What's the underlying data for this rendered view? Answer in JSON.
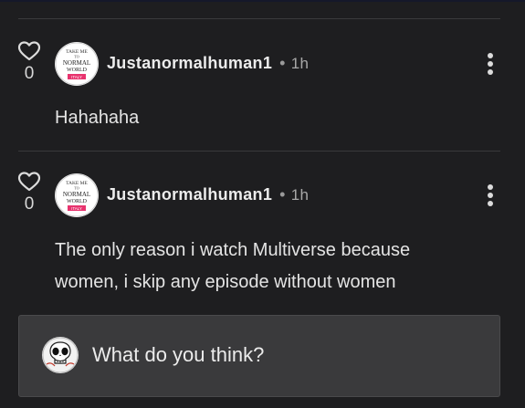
{
  "comments": [
    {
      "likes": "0",
      "username": "Justanormalhuman1",
      "separator": "•",
      "time": "1h",
      "text": "Hahahaha",
      "avatar_text": [
        "TAKE ME",
        "TO",
        "NORMAL",
        "WORLD",
        "ITALY"
      ]
    },
    {
      "likes": "0",
      "username": "Justanormalhuman1",
      "separator": "•",
      "time": "1h",
      "text": "The only reason i watch Multiverse because women, i skip any episode without women",
      "avatar_text": [
        "TAKE ME",
        "TO",
        "NORMAL",
        "WORLD",
        "ITALY"
      ]
    }
  ],
  "reply": {
    "placeholder": "What do you think?"
  },
  "colors": {
    "background": "#1e1e20",
    "divider": "#3a3a3c",
    "reply_box": "#3a3a3c",
    "badge_pink": "#e8336e"
  },
  "icons": {
    "like": "heart-outline-icon",
    "more": "vertical-ellipsis-icon",
    "reply_avatar": "skull-face-icon"
  }
}
